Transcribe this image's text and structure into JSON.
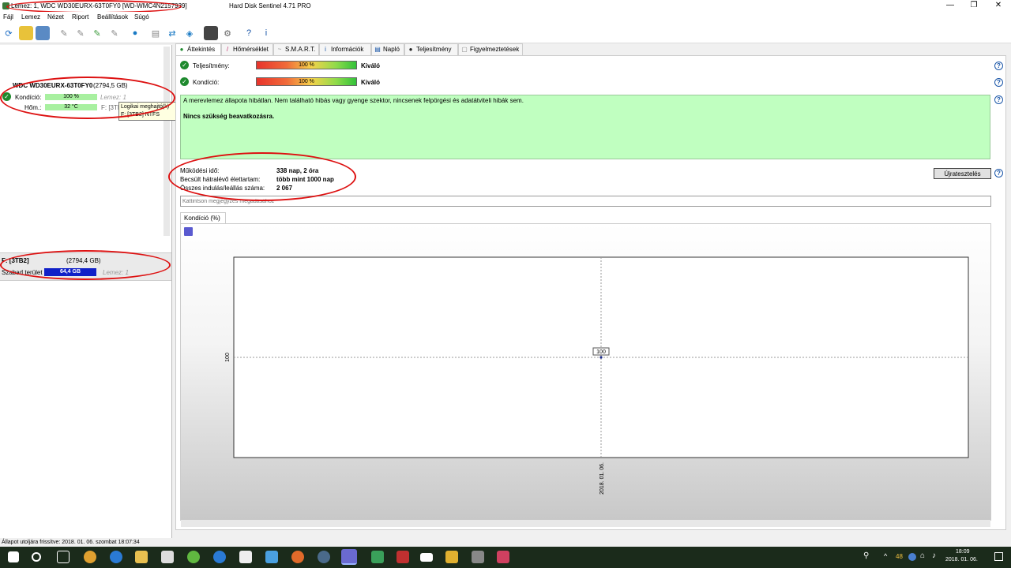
{
  "window": {
    "document_title": "Lemez: 1, WDC WD30EURX-63T0FY0 [WD-WMC4N2157939]",
    "app_title": "Hard Disk Sentinel 4.71 PRO",
    "minimize": "—",
    "maximize": "❐",
    "close": "✕"
  },
  "menu": [
    "Fájl",
    "Lemez",
    "Nézet",
    "Riport",
    "Beállítások",
    "Súgó"
  ],
  "left": {
    "disk_name": "WDC WD30EURX-63T0FY0",
    "disk_size": "(2794,5 GB)",
    "health_label": "Kondíció:",
    "health_value": "100 %",
    "temp_label": "Hőm.:",
    "temp_value": "32 °C",
    "disk_ref": "Lemez: 1",
    "drive_ref": "F: [3TB",
    "tooltip_line1": "Logikai meghajtó(k)",
    "tooltip_line2": "F: [3TB2] NTFS",
    "volume_name": "F: [3TB2]",
    "volume_size": "(2794,4 GB)",
    "free_label": "Szabad terület",
    "free_value": "64,4 GB",
    "volume_disk_ref": "Lemez: 1"
  },
  "tabs": [
    "Áttekintés",
    "Hőmérséklet",
    "S.M.A.R.T.",
    "Információk",
    "Napló",
    "Teljesítmény",
    "Figyelmeztetések"
  ],
  "overview": {
    "performance_label": "Teljesítmény:",
    "performance_value": "100 %",
    "performance_rating": "Kiváló",
    "health_label": "Kondíció:",
    "health_value": "100 %",
    "health_rating": "Kiváló",
    "message": "A merevlemez állapota hibátlan. Nem található hibás vagy gyenge szektor, nincsenek felpörgési és adatátviteli hibák sem.",
    "action": "Nincs szükség beavatkozásra.",
    "uptime_label": "Működési idő:",
    "uptime_value": "338 nap, 2 óra",
    "lifetime_label": "Becsült hátralévő élettartam:",
    "lifetime_value": "több mint 1000 nap",
    "startstop_label": "Összes indulás/leállás száma:",
    "startstop_value": "2 067",
    "retest_button": "Újratesztelés",
    "note_placeholder": "Kattintson megjegyzés megadásához",
    "chart_tab": "Kondíció  (%)"
  },
  "chart_data": {
    "type": "line",
    "x": [
      "2018. 01. 06."
    ],
    "series": [
      {
        "values": [
          100
        ]
      }
    ],
    "data_labels": [
      "100"
    ],
    "ytick_labels": [
      "100"
    ],
    "xtick_labels": [
      "2018. 01. 06."
    ],
    "grid": true
  },
  "status": "Állapot utoljára frissítve: 2018. 01. 06. szombat 18:07:34",
  "taskbar": {
    "temp": "48",
    "time": "18:09",
    "date": "2018. 01. 06."
  },
  "colors": {
    "message_bg": "#c0ffc0",
    "oval": "#dd1111",
    "taskbar": "#1b2b1b",
    "free_bar": "#1020c8"
  }
}
